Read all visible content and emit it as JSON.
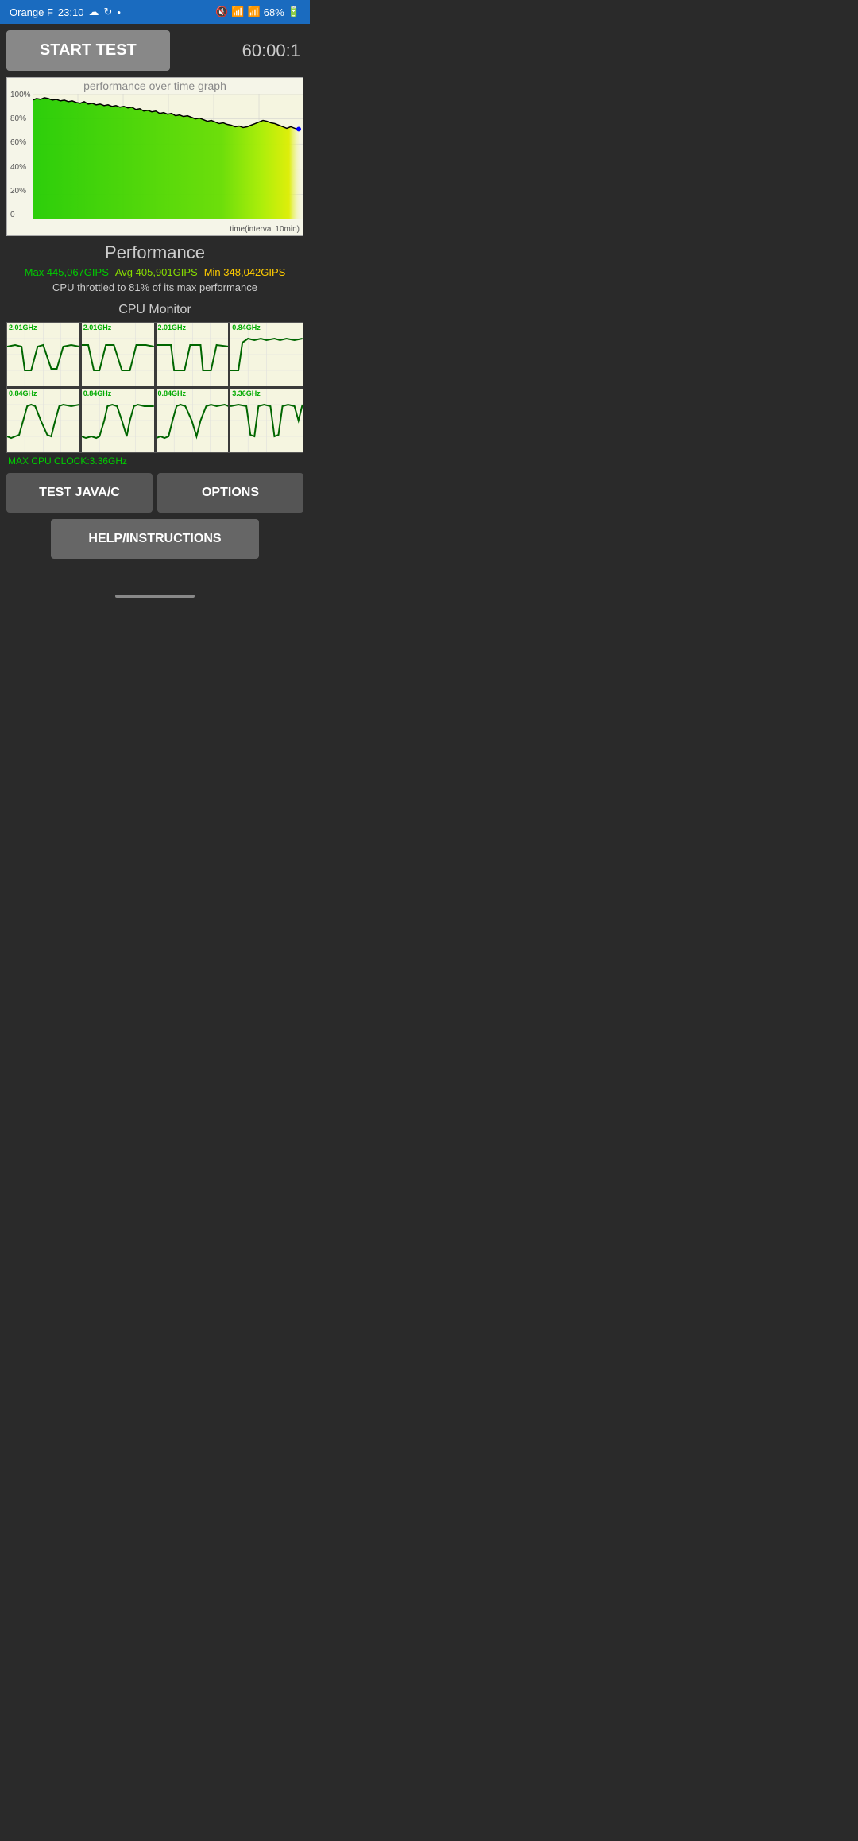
{
  "statusBar": {
    "carrier": "Orange F",
    "time": "23:10",
    "batteryPercent": "68%"
  },
  "topControls": {
    "startTestLabel": "START TEST",
    "timerValue": "60:00:1"
  },
  "graph": {
    "title": "performance over time graph",
    "yLabels": [
      "100%",
      "80%",
      "60%",
      "40%",
      "20%",
      "0"
    ],
    "xLabel": "time(interval 10min)"
  },
  "performance": {
    "title": "Performance",
    "maxLabel": "Max 445,067GIPS",
    "avgLabel": "Avg 405,901GIPS",
    "minLabel": "Min 348,042GIPS",
    "throttleText": "CPU throttled to 81% of its max performance"
  },
  "cpuMonitor": {
    "title": "CPU Monitor",
    "cells": [
      {
        "freq": "2.01GHz"
      },
      {
        "freq": "2.01GHz"
      },
      {
        "freq": "2.01GHz"
      },
      {
        "freq": "0.84GHz"
      },
      {
        "freq": "0.84GHz"
      },
      {
        "freq": "0.84GHz"
      },
      {
        "freq": "0.84GHz"
      },
      {
        "freq": "3.36GHz"
      }
    ],
    "maxCpuLabel": "MAX CPU CLOCK:3.36GHz"
  },
  "buttons": {
    "testJavaC": "TEST JAVA/C",
    "options": "OPTIONS",
    "helpInstructions": "HELP/INSTRUCTIONS"
  }
}
